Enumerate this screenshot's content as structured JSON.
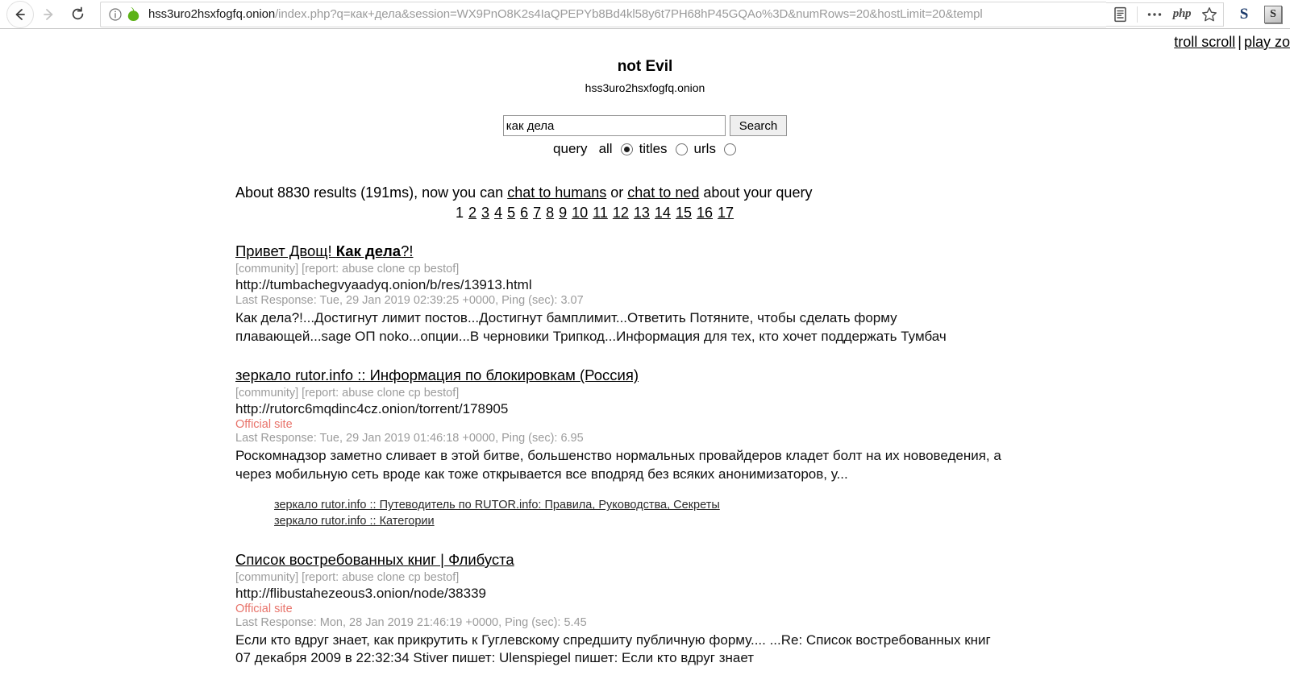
{
  "browser": {
    "url_host": "hss3uro2hsxfogfq.onion",
    "url_rest": "/index.php?q=как+дела&session=WX9PnO8K2s4IaQPEPYb8Bd4kl58y6t7PH68hP45GQAo%3D&numRows=20&hostLimit=20&templ",
    "back_label": "Back",
    "forward_label": "Forward",
    "reload_label": "Reload",
    "info_icon": "info-circle-icon",
    "onion_icon": "onion-icon",
    "reader_icon": "reader-view-icon",
    "menu_icon": "more-options-icon",
    "php_label": "php",
    "bookmark_icon": "star-icon",
    "ext_s_label": "S",
    "ext_s_boxed_label": "S"
  },
  "corner": {
    "link1": "troll scroll",
    "separator": "|",
    "link2": "play zo"
  },
  "site": {
    "title": "not Evil",
    "subtitle": "hss3uro2hsxfogfq.onion"
  },
  "search": {
    "value": "как дела",
    "placeholder": "",
    "button": "Search",
    "scope_label": "query",
    "option_all": "all",
    "option_titles": "titles",
    "option_urls": "urls",
    "selected": "all"
  },
  "summary": {
    "prefix": "About 8830 results (191ms), now you can ",
    "link_humans": "chat to humans",
    "middle": " or ",
    "link_ned": "chat to ned",
    "suffix": " about your query"
  },
  "pagination": {
    "current": "1",
    "pages": [
      "2",
      "3",
      "4",
      "5",
      "6",
      "7",
      "8",
      "9",
      "10",
      "11",
      "12",
      "13",
      "14",
      "15",
      "16",
      "17"
    ]
  },
  "results": [
    {
      "title_pre": "Привет Двощ! ",
      "title_bold": "Как дела",
      "title_post": "?!",
      "tags": "[community] [report: abuse clone cp bestof]",
      "url": "http://tumbachegvyaadyq.onion/b/res/13913.html",
      "official": "",
      "meta": "Last Response: Tue, 29 Jan 2019 02:39:25 +0000, Ping (sec): 3.07",
      "snippet": "Как дела?!...Достигнут лимит постов...Достигнут бамплимит...Ответить Потяните, чтобы сделать форму плавающей...sage ОП noko...опции...В черновики Трипкод...Информация для тех, кто хочет поддержать Тумбач",
      "sublinks": []
    },
    {
      "title_pre": "зеркало rutor.info :: Информация по блокировкам (Россия)",
      "title_bold": "",
      "title_post": "",
      "tags": "[community] [report: abuse clone cp bestof]",
      "url": "http://rutorc6mqdinc4cz.onion/torrent/178905",
      "official": "Official site",
      "meta": "Last Response: Tue, 29 Jan 2019 01:46:18 +0000, Ping (sec): 6.95",
      "snippet": "Роскомнадзор заметно сливает в этой битве, большенство нормальных провайдеров кладет болт на их нововедения, а через мобильную сеть вроде как тоже открывается все вподряд без всяких анонимизаторов, у...",
      "sublinks": [
        "зеркало rutor.info :: Путеводитель по RUTOR.info: Правила, Руководства, Секреты",
        "зеркало rutor.info :: Категории"
      ]
    },
    {
      "title_pre": "Список востребованных книг | Флибуста",
      "title_bold": "",
      "title_post": "",
      "tags": "[community] [report: abuse clone cp bestof]",
      "url": "http://flibustahezeous3.onion/node/38339",
      "official": "Official site",
      "meta": "Last Response: Mon, 28 Jan 2019 21:46:19 +0000, Ping (sec): 5.45",
      "snippet": "Если кто вдруг знает, как прикрутить к Гуглевскому спредшиту публичную форму.... ...Re: Список востребованных книг  07 декабря 2009  в 22:32:34 Stiver пишет:   Ulenspiegel пишет:   Если кто вдруг знает",
      "sublinks": []
    }
  ]
}
